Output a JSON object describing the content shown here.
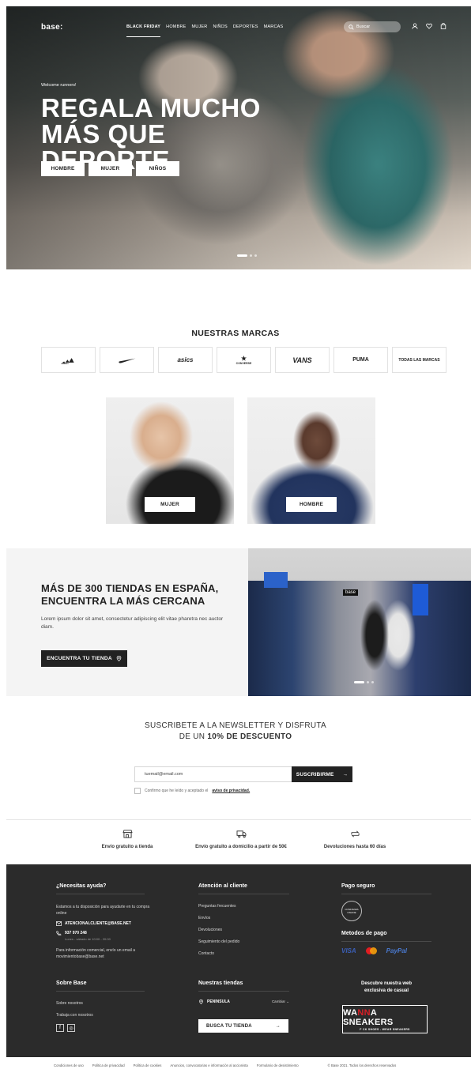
{
  "header": {
    "logo": "base:",
    "nav": [
      "BLACK FRIDAY",
      "HOMBRE",
      "MUJER",
      "NIÑOS",
      "DEPORTES",
      "MARCAS"
    ],
    "search_placeholder": "Buscar",
    "icons": [
      "user-icon",
      "heart-icon",
      "bag-icon"
    ]
  },
  "hero": {
    "eyebrow": "Welcome runners!",
    "headline_line1": "REGALA MUCHO",
    "headline_line2": "MÁS QUE DEPORTE",
    "buttons": [
      "HOMBRE",
      "MUJER",
      "NIÑOS"
    ],
    "slides_total": 3,
    "slide_active": 1
  },
  "brands": {
    "title": "NUESTRAS MARCAS",
    "items": [
      "adidas",
      "nike",
      "asics",
      "CONVERSE",
      "VANS",
      "PUMA",
      "TODAS LAS MARCAS"
    ]
  },
  "categories": [
    {
      "label": "MUJER"
    },
    {
      "label": "HOMBRE"
    }
  ],
  "stores": {
    "title_line1": "MÁS DE 300 TIENDAS EN ESPAÑA,",
    "title_line2": "ENCUENTRA LA MÁS CERCANA",
    "body": "Lorem ipsum dolor sit amet, consectetur adipiscing elit vitae pharetra nec auctor diam.",
    "button": "ENCUENTRA TU TIENDA",
    "store_sign": "base"
  },
  "newsletter": {
    "title_line1": "SUSCRIBETE A LA NEWSLETTER Y DISFRUTA",
    "title_line2_prefix": "DE UN ",
    "title_line2_bold": "10% DE DESCUENTO",
    "email_value": "tuemail@email.com",
    "button": "SUSCRIBIRME",
    "consent_text": "Confirmo que he leído y aceptado el",
    "consent_link": "aviso de privacidad."
  },
  "benefits": [
    {
      "icon": "store-icon",
      "label": "Envío gratuito a tienda"
    },
    {
      "icon": "truck-icon",
      "label": "Envío gratuito a domicilio a partir de 50€"
    },
    {
      "icon": "return-icon",
      "label": "Devoluciones hasta 60 días"
    }
  ],
  "footer": {
    "help": {
      "title": "¿Necesitas ayuda?",
      "text": "Estamos a tu disposición para ayudarte en tu compra online",
      "email": "ATENCIONALCLIENTE@BASE.NET",
      "phone": "937 970 248",
      "hours": "Lunes - sábado de 10:00 - 20:00",
      "commercial": "Para información comercial, envío un email a movimientobase@base.net"
    },
    "customer": {
      "title": "Atención al cliente",
      "links": [
        "Preguntas frecuentes",
        "Envíos",
        "Devoluciones",
        "Seguimiento del pedido",
        "Contacto"
      ]
    },
    "secure": {
      "title": "Pago seguro",
      "badge": "CONFIANZA ONLINE",
      "methods_title": "Metodos de pago",
      "methods": [
        "VISA",
        "PayPal"
      ]
    },
    "about": {
      "title": "Sobre Base",
      "links": [
        "Sobre nosotros",
        "Trabaja con nosotros"
      ],
      "social": [
        "f",
        "◎"
      ]
    },
    "stores": {
      "title": "Nuestras tiendas",
      "region": "PENINSULA",
      "change": "Cambiar",
      "button": "BUSCA TU TIENDA"
    },
    "promo": {
      "text_line1": "Descubre nuestra web",
      "text_line2": "exclusiva de casual",
      "logo_main_a": "WA",
      "logo_main_b": "NN",
      "logo_main_c": "A SNEAKERS",
      "logo_sub": "F CK SHOES - WEAR SNEAKERS"
    }
  },
  "legal": {
    "links": [
      "Condiciones de uso",
      "Política de privacidad",
      "Política de cookies",
      "Anuncios, convocatorias e información al accionista",
      "Formulario de desistimiento"
    ],
    "copyright": "© Base 2021. Todos los derechos reservados"
  },
  "colors": {
    "dark": "#2b2b2b",
    "accent_red": "#d91f26",
    "light_bg": "#f4f4f4"
  }
}
